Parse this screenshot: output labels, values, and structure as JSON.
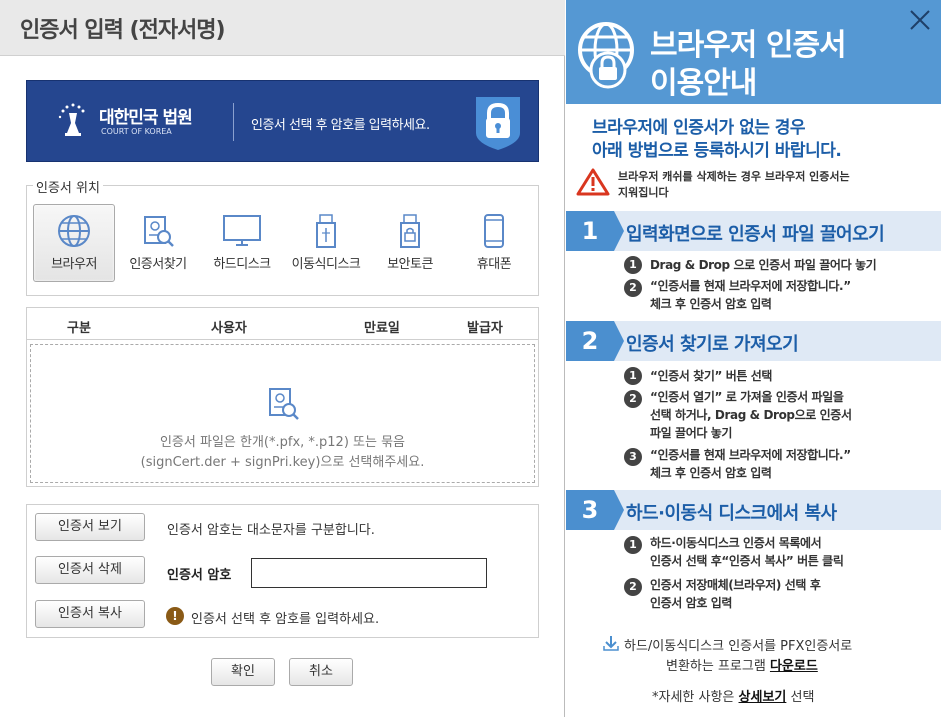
{
  "dialog": {
    "title": "인증서 입력 (전자서명)",
    "banner": {
      "court_name": "대한민국 법원",
      "court_name_en": "COURT OF KOREA",
      "message": "인증서 선택 후 암호를 입력하세요."
    },
    "location": {
      "legend": "인증서 위치",
      "items": [
        {
          "label": "브라우저",
          "icon": "globe-icon",
          "selected": true
        },
        {
          "label": "인증서찾기",
          "icon": "certificate-search-icon",
          "selected": false
        },
        {
          "label": "하드디스크",
          "icon": "monitor-icon",
          "selected": false
        },
        {
          "label": "이동식디스크",
          "icon": "usb-icon",
          "selected": false
        },
        {
          "label": "보안토큰",
          "icon": "token-icon",
          "selected": false
        },
        {
          "label": "휴대폰",
          "icon": "phone-icon",
          "selected": false
        }
      ]
    },
    "table": {
      "columns": [
        "구분",
        "사용자",
        "만료일",
        "발급자"
      ],
      "empty_line1": "인증서 파일은 한개(*.pfx, *.p12) 또는 묶음",
      "empty_line2": "(signCert.der + signPri.key)으로 선택해주세요."
    },
    "actions": {
      "view": "인증서 보기",
      "delete": "인증서 삭제",
      "copy": "인증서 복사",
      "case_note": "인증서 암호는 대소문자를 구분합니다.",
      "password_label": "인증서 암호",
      "password_value": "",
      "warning": "인증서 선택 후 암호를 입력하세요."
    },
    "footer": {
      "ok": "확인",
      "cancel": "취소"
    }
  },
  "guide": {
    "title_line1": "브라우저 인증서",
    "title_line2": "이용안내",
    "intro_line1": "브라우저에 인증서가 없는 경우",
    "intro_line2": "아래 방법으로 등록하시기 바랍니다.",
    "alert_line1": "브라우저 캐쉬를 삭제하는 경우 브라우저 인증서는",
    "alert_line2": "지워집니다",
    "steps": [
      {
        "num": "1",
        "title": "입력화면으로 인증서 파일 끌어오기",
        "items": [
          {
            "n": "1",
            "lines": [
              "Drag & Drop 으로 인증서 파일 끌어다 놓기"
            ]
          },
          {
            "n": "2",
            "lines": [
              "“인증서를 현재 브라우저에 저장합니다.”",
              "체크 후 인증서 암호 입력"
            ]
          }
        ]
      },
      {
        "num": "2",
        "title": "인증서 찾기로 가져오기",
        "items": [
          {
            "n": "1",
            "lines": [
              "“인증서 찾기” 버튼 선택"
            ]
          },
          {
            "n": "2",
            "lines": [
              "“인증서 열기” 로 가져올 인증서 파일을",
              "선택 하거나, Drag & Drop으로 인증서",
              "파일 끌어다 놓기"
            ]
          },
          {
            "n": "3",
            "lines": [
              "“인증서를 현재 브라우저에 저장합니다.”",
              "체크 후 인증서 암호 입력"
            ]
          }
        ]
      },
      {
        "num": "3",
        "title": "하드·이동식 디스크에서 복사",
        "items": [
          {
            "n": "1",
            "lines": [
              "하드·이동식디스크 인증서 목록에서",
              "인증서 선택 후“인증서 복사” 버튼 클릭"
            ]
          },
          {
            "n": "2",
            "lines": [
              "인증서 저장매체(브라우저) 선택 후",
              "인증서 암호 입력"
            ]
          }
        ]
      }
    ],
    "download_line1": "하드/이동식디스크 인증서를 PFX인증서로",
    "download_line2_prefix": "변환하는 프로그램 ",
    "download_link": "다운로드",
    "detail_prefix": "*자세한 사항은 ",
    "detail_link": "상세보기",
    "detail_suffix": " 선택"
  },
  "colors": {
    "banner_bg": "#25468f",
    "guide_header_bg": "#5598d3",
    "step_bg": "#dfe9f5",
    "step_num_bg": "#4b8fcf",
    "accent_text": "#1c5ea8"
  }
}
